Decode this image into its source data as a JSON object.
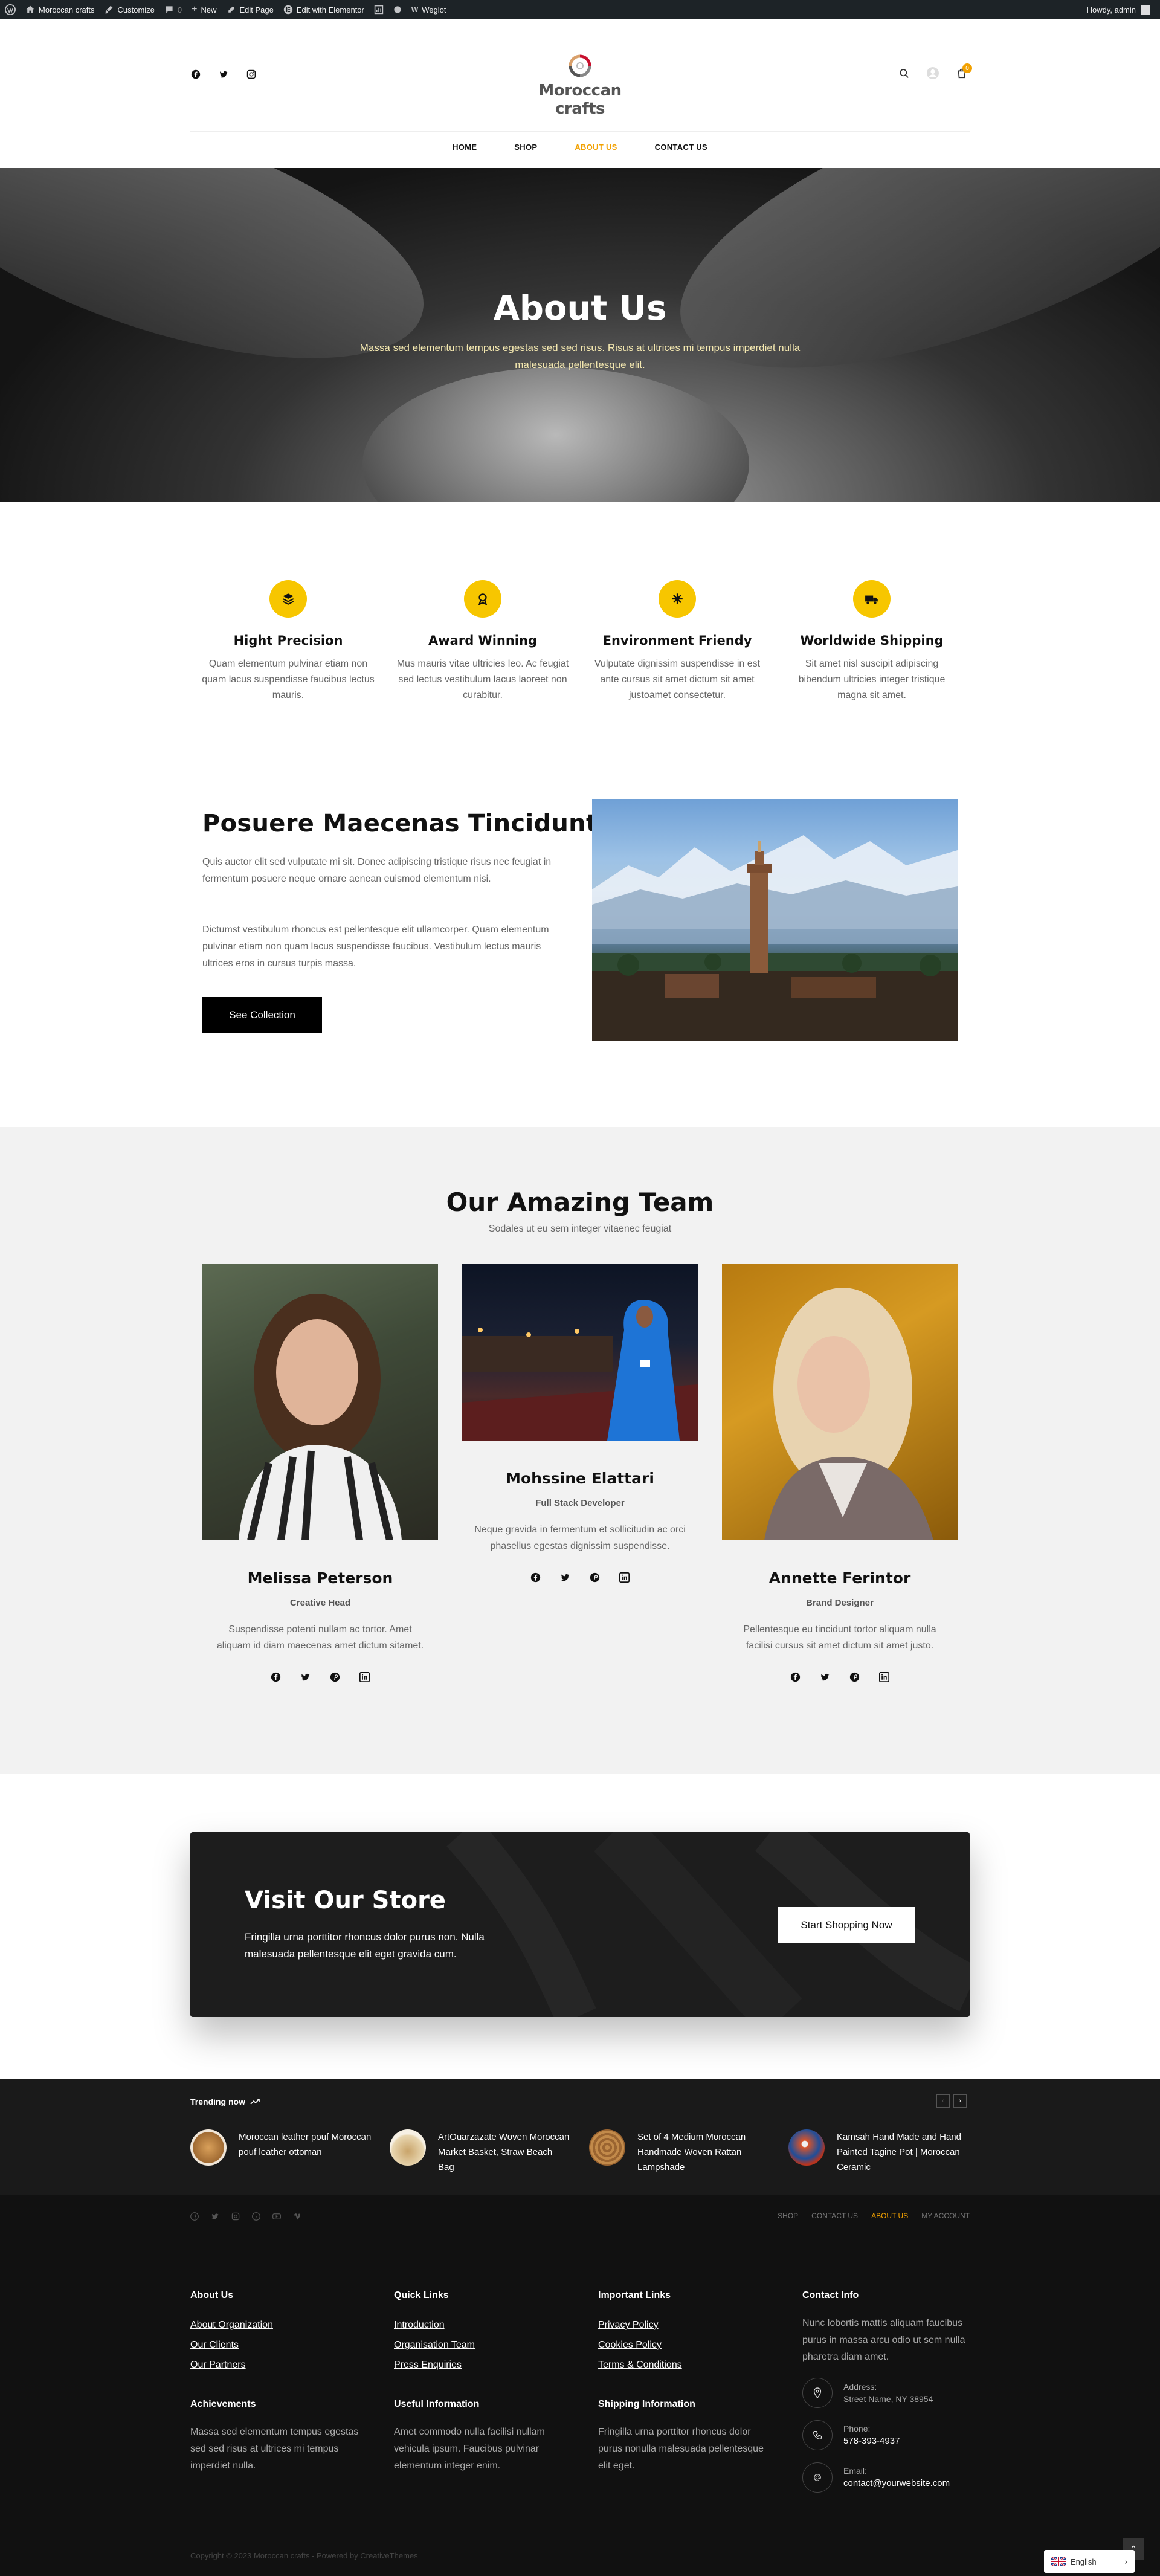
{
  "admin_bar": {
    "site_name": "Moroccan crafts",
    "customize": "Customize",
    "comments_count": "0",
    "new": "New",
    "edit_page": "Edit Page",
    "edit_elementor": "Edit with Elementor",
    "weglot": "Weglot",
    "howdy": "Howdy, admin"
  },
  "header": {
    "logo_text": "Moroccan crafts",
    "cart_count": "0",
    "nav": [
      "HOME",
      "SHOP",
      "ABOUT US",
      "CONTACT US"
    ],
    "active_nav": "ABOUT US"
  },
  "hero": {
    "title": "About Us",
    "text": "Massa sed elementum tempus egestas sed sed risus. Risus at ultrices mi tempus imperdiet nulla malesuada pellentesque elit."
  },
  "features": [
    {
      "title": "Hight Precision",
      "text": "Quam elementum pulvinar etiam non quam lacus suspendisse faucibus lectus mauris.",
      "icon": "layers-icon"
    },
    {
      "title": "Award Winning",
      "text": "Mus mauris vitae ultricies leo. Ac feugiat sed lectus vestibulum lacus laoreet non curabitur.",
      "icon": "award-icon"
    },
    {
      "title": "Environment Friendy",
      "text": "Vulputate dignissim suspendisse in est ante cursus sit amet dictum sit amet justoamet consectetur.",
      "icon": "snowflake-icon"
    },
    {
      "title": "Worldwide Shipping",
      "text": "Sit amet nisl suscipit adipiscing bibendum ultricies integer tristique magna sit amet.",
      "icon": "truck-icon"
    }
  ],
  "about": {
    "title": "Posuere Maecenas Tincidunt",
    "paragraph1": "Quis auctor elit sed vulputate mi sit. Donec adipiscing tristique risus nec feugiat in fermentum posuere neque ornare aenean euismod elementum nisi.",
    "paragraph2": "Dictumst vestibulum rhoncus est pellentesque elit ullamcorper. Quam elementum pulvinar etiam non quam lacus suspendisse faucibus. Vestibulum lectus mauris ultrices eros in cursus turpis massa.",
    "button": "See Collection"
  },
  "team": {
    "title": "Our Amazing Team",
    "subtitle": "Sodales ut eu sem integer vitaenec feugiat",
    "members": [
      {
        "name": "Melissa Peterson",
        "role": "Creative Head",
        "text": "Suspendisse potenti nullam ac tortor. Amet aliquam id diam maecenas amet dictum sitamet."
      },
      {
        "name": "Mohssine Elattari",
        "role": "Full Stack Developer",
        "text": "Neque gravida in fermentum et sollicitudin ac orci phasellus egestas dignissim suspendisse."
      },
      {
        "name": "Annette Ferintor",
        "role": "Brand Designer",
        "text": "Pellentesque eu tincidunt tortor aliquam nulla facilisi cursus sit amet dictum sit amet justo."
      }
    ]
  },
  "store": {
    "title": "Visit Our Store",
    "text": "Fringilla urna porttitor rhoncus dolor purus non. Nulla malesuada pellentesque elit eget gravida cum.",
    "button": "Start Shopping Now"
  },
  "trending": {
    "title": "Trending now",
    "items": [
      {
        "text": "Moroccan leather pouf Moroccan pouf leather ottoman"
      },
      {
        "text": "ArtOuarzazate Woven Moroccan Market Basket, Straw Beach Bag"
      },
      {
        "text": "Set of 4 Medium Moroccan Handmade Woven Rattan Lampshade"
      },
      {
        "text": "Kamsah Hand Made and Hand Painted Tagine Pot | Moroccan Ceramic"
      }
    ]
  },
  "footer_bar": {
    "links": [
      "SHOP",
      "CONTACT US",
      "ABOUT US",
      "MY ACCOUNT"
    ],
    "active": "ABOUT US"
  },
  "footer": {
    "about_us": {
      "title": "About Us",
      "links": [
        "About Organization",
        "Our Clients",
        "Our Partners"
      ]
    },
    "quick_links": {
      "title": "Quick Links",
      "links": [
        "Introduction",
        "Organisation Team",
        "Press Enquiries"
      ]
    },
    "important_links": {
      "title": "Important Links",
      "links": [
        "Privacy Policy",
        "Cookies Policy",
        "Terms & Conditions"
      ]
    },
    "contact": {
      "title": "Contact Info",
      "text": "Nunc lobortis mattis aliquam faucibus purus in massa arcu odio ut sem nulla pharetra diam amet.",
      "address_label": "Address:",
      "address": "Street Name, NY 38954",
      "phone_label": "Phone:",
      "phone": "578-393-4937",
      "email_label": "Email:",
      "email": "contact@yourwebsite.com"
    },
    "achievements": {
      "title": "Achievements",
      "text": "Massa sed elementum tempus egestas sed sed risus at ultrices mi tempus imperdiet nulla."
    },
    "useful_info": {
      "title": "Useful Information",
      "text": "Amet commodo nulla facilisi nullam vehicula ipsum. Faucibus pulvinar elementum integer enim."
    },
    "shipping_info": {
      "title": "Shipping Information",
      "text": "Fringilla urna porttitor rhoncus dolor purus nonulla malesuada pellentesque elit eget."
    },
    "copyright": "Copyright © 2023 Moroccan crafts - Powered by CreativeThemes",
    "language": "English"
  },
  "colors": {
    "accent": "#f2a100",
    "feature_icon": "#f7c600",
    "dark": "#111111"
  }
}
